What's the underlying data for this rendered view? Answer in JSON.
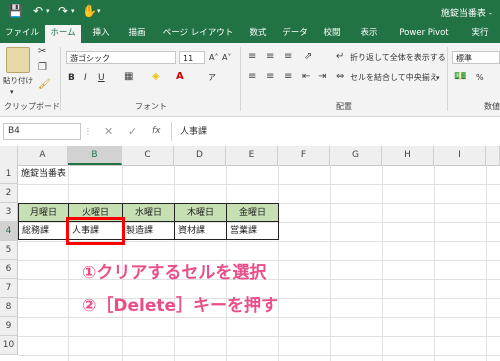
{
  "title_bar": {
    "document_title": "施錠当番表 -",
    "save_icon": "save-icon",
    "undo_icon": "undo-icon",
    "redo_icon": "redo-icon",
    "touch_icon": "touch-mode-icon"
  },
  "tabs": [
    "ファイル",
    "ホーム",
    "挿入",
    "描画",
    "ページ レイアウト",
    "数式",
    "データ",
    "校閲",
    "表示",
    "Power Pivot",
    "実行"
  ],
  "active_tab": "ホーム",
  "ribbon": {
    "clipboard": {
      "paste_label": "貼り付け",
      "group_label": "クリップボード"
    },
    "font": {
      "font_name": "游ゴシック",
      "font_size": "11",
      "bold": "B",
      "italic": "I",
      "underline": "U",
      "group_label": "フォント"
    },
    "alignment": {
      "wrap_text": "折り返して全体を表示する",
      "merge_center": "セルを結合して中央揃え",
      "group_label": "配置"
    },
    "number": {
      "format": "標準",
      "group_label": "数値"
    }
  },
  "formula_bar": {
    "name_box": "B4",
    "fx": "fx",
    "content": "人事課"
  },
  "columns": [
    "A",
    "B",
    "C",
    "D",
    "E",
    "F",
    "G",
    "H",
    "I"
  ],
  "rows": [
    "1",
    "2",
    "3",
    "4",
    "5",
    "6",
    "7",
    "8",
    "9",
    "10"
  ],
  "selected_cell": "B4",
  "cells": {
    "A1": "施錠当番表",
    "A3": "月曜日",
    "B3": "火曜日",
    "C3": "水曜日",
    "D3": "木曜日",
    "E3": "金曜日",
    "A4": "総務課",
    "B4": "人事課",
    "C4": "製造課",
    "D4": "資材課",
    "E4": "営業課"
  },
  "instructions": [
    "①クリアするセルを選択",
    "②［Delete］キーを押す"
  ],
  "colors": {
    "excel_green": "#217346",
    "header_fill": "#c6e0b4",
    "highlight": "#ff0000",
    "instruction_text": "#ea4e8a"
  }
}
